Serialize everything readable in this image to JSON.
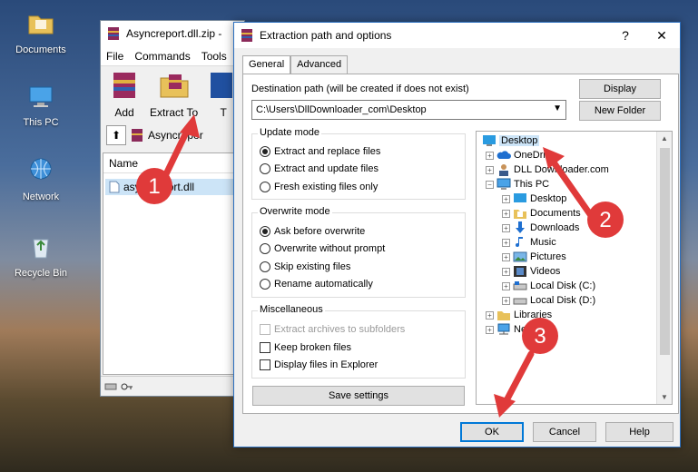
{
  "desktop": {
    "icons": [
      {
        "label": "Documents"
      },
      {
        "label": "This PC"
      },
      {
        "label": "Network"
      },
      {
        "label": "Recycle Bin"
      }
    ]
  },
  "winrar": {
    "title": "Asyncreport.dll.zip -",
    "menu": [
      "File",
      "Commands",
      "Tools"
    ],
    "tools": [
      {
        "label": "Add"
      },
      {
        "label": "Extract To"
      },
      {
        "label": "T"
      }
    ],
    "path_label": "Asyncrepor",
    "list_header": "Name",
    "file_name": "asyncreport.dll"
  },
  "dialog": {
    "title": "Extraction path and options",
    "help_glyph": "?",
    "close_glyph": "✕",
    "tabs": [
      {
        "label": "General",
        "active": true
      },
      {
        "label": "Advanced",
        "active": false
      }
    ],
    "destination_label": "Destination path (will be created if does not exist)",
    "destination_value": "C:\\Users\\DllDownloader_com\\Desktop",
    "display_button": "Display",
    "new_folder_button": "New Folder",
    "update_mode": {
      "title": "Update mode",
      "options": [
        "Extract and replace files",
        "Extract and update files",
        "Fresh existing files only"
      ],
      "selected": 0
    },
    "overwrite_mode": {
      "title": "Overwrite mode",
      "options": [
        "Ask before overwrite",
        "Overwrite without prompt",
        "Skip existing files",
        "Rename automatically"
      ],
      "selected": 0
    },
    "misc": {
      "title": "Miscellaneous",
      "options": [
        {
          "label": "Extract archives to subfolders",
          "disabled": true
        },
        {
          "label": "Keep broken files",
          "disabled": false
        },
        {
          "label": "Display files in Explorer",
          "disabled": false
        }
      ]
    },
    "save_settings_button": "Save settings",
    "ok_button": "OK",
    "cancel_button": "Cancel",
    "help_button": "Help",
    "tree": [
      {
        "label": "Desktop",
        "level": 0,
        "selected": true
      },
      {
        "label": "OneDrive",
        "level": 1
      },
      {
        "label": "DLL Downloader.com",
        "level": 1
      },
      {
        "label": "This PC",
        "level": 1
      },
      {
        "label": "Desktop",
        "level": 2
      },
      {
        "label": "Documents",
        "level": 2
      },
      {
        "label": "Downloads",
        "level": 2
      },
      {
        "label": "Music",
        "level": 2
      },
      {
        "label": "Pictures",
        "level": 2
      },
      {
        "label": "Videos",
        "level": 2
      },
      {
        "label": "Local Disk (C:)",
        "level": 2
      },
      {
        "label": "Local Disk (D:)",
        "level": 2
      },
      {
        "label": "Libraries",
        "level": 1
      },
      {
        "label": "Network",
        "level": 1
      }
    ]
  },
  "annotations": [
    "1",
    "2",
    "3"
  ],
  "colors": {
    "annotation": "#e03a3a",
    "selection": "#cce4f7",
    "accent": "#0078d7"
  }
}
